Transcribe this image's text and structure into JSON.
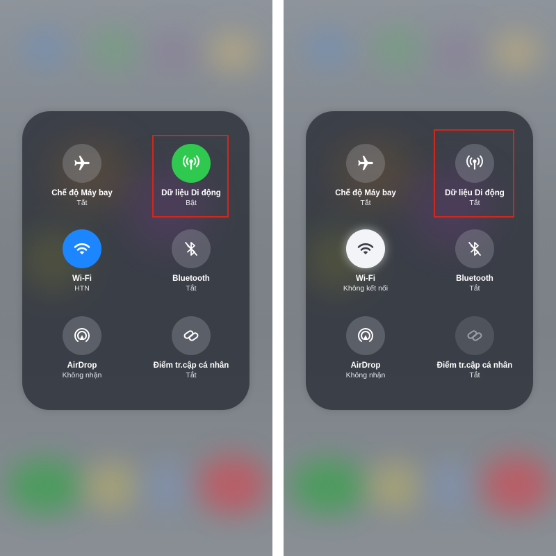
{
  "panels": [
    {
      "tiles": [
        {
          "label": "Chế độ Máy bay",
          "status": "Tắt",
          "icon": "airplane-icon",
          "state": "off"
        },
        {
          "label": "Dữ liệu Di động",
          "status": "Bật",
          "icon": "cellular-antenna-icon",
          "state": "on",
          "color": "#30c94f"
        },
        {
          "label": "Wi-Fi",
          "status": "HTN",
          "icon": "wifi-icon",
          "state": "on",
          "color": "#1b86ff"
        },
        {
          "label": "Bluetooth",
          "status": "Tắt",
          "icon": "bluetooth-icon",
          "state": "off"
        },
        {
          "label": "AirDrop",
          "status": "Không nhận",
          "icon": "airdrop-icon",
          "state": "off"
        },
        {
          "label": "Điểm tr.cập cá nhân",
          "status": "Tắt",
          "icon": "personal-hotspot-icon",
          "state": "off"
        }
      ],
      "highlight_color": "#d5261a"
    },
    {
      "tiles": [
        {
          "label": "Chế độ Máy bay",
          "status": "Tắt",
          "icon": "airplane-icon",
          "state": "off"
        },
        {
          "label": "Dữ liệu Di động",
          "status": "Tắt",
          "icon": "cellular-antenna-icon",
          "state": "off"
        },
        {
          "label": "Wi-Fi",
          "status": "Không kết nối",
          "icon": "wifi-icon",
          "state": "on-not-connected",
          "color": "#f2f4f8"
        },
        {
          "label": "Bluetooth",
          "status": "Tắt",
          "icon": "bluetooth-icon",
          "state": "off"
        },
        {
          "label": "AirDrop",
          "status": "Không nhận",
          "icon": "airdrop-icon",
          "state": "off"
        },
        {
          "label": "Điểm tr.cập cá nhân",
          "status": "Tắt",
          "icon": "personal-hotspot-icon",
          "state": "disabled"
        }
      ],
      "highlight_color": "#d5261a"
    }
  ]
}
